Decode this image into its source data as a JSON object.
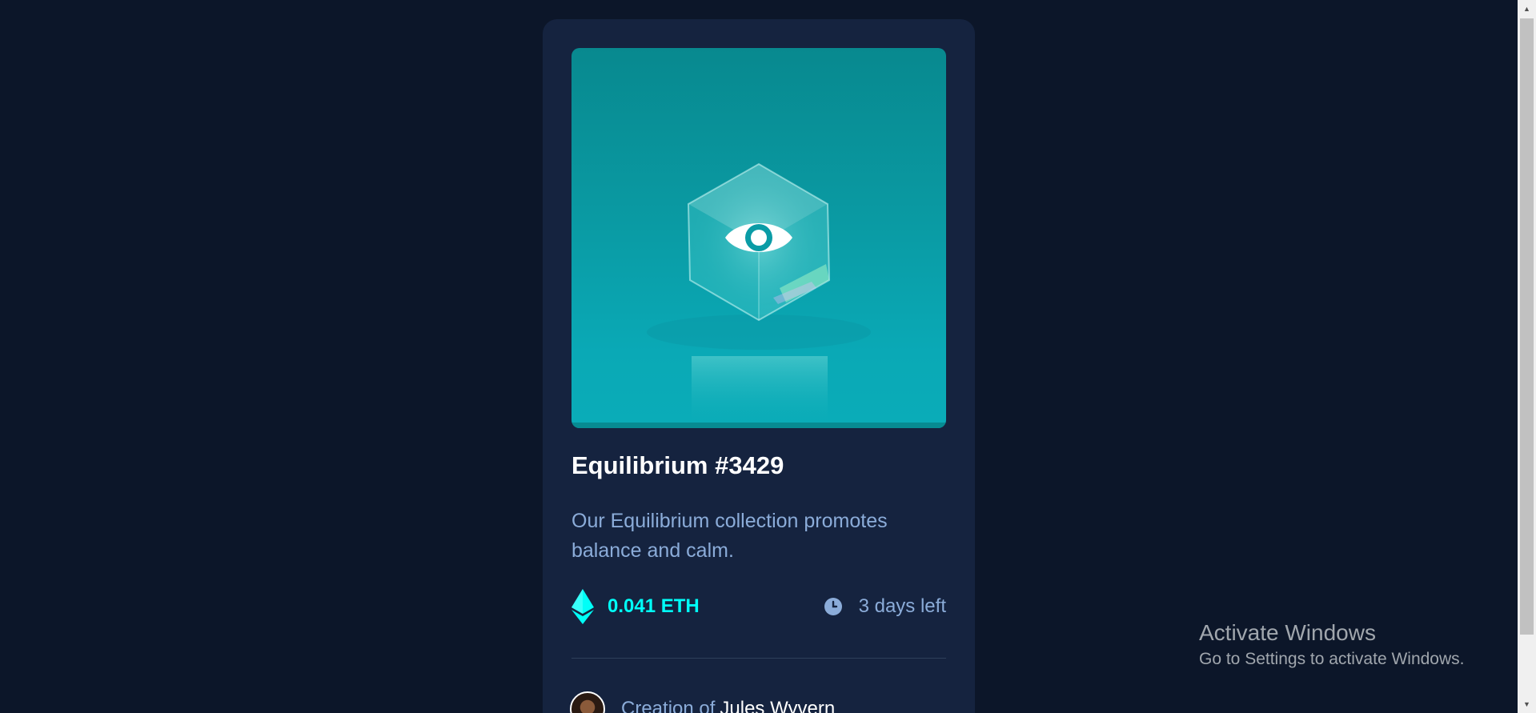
{
  "card": {
    "title": "Equilibrium #3429",
    "description": "Our Equilibrium collection promotes balance and calm.",
    "price": "0.041 ETH",
    "time_left": "3 days left",
    "creator_prefix": "Creation of",
    "creator_name": "Jules Wyvern"
  },
  "icons": {
    "hero": "eye-icon",
    "price": "ethereum-icon",
    "time": "clock-icon"
  },
  "watermark": {
    "title": "Activate Windows",
    "subtitle": "Go to Settings to activate Windows."
  },
  "colors": {
    "background": "#0c1629",
    "card": "#15233f",
    "cyan": "#00fff8",
    "soft_blue": "#8bacd9",
    "white": "#ffffff"
  }
}
